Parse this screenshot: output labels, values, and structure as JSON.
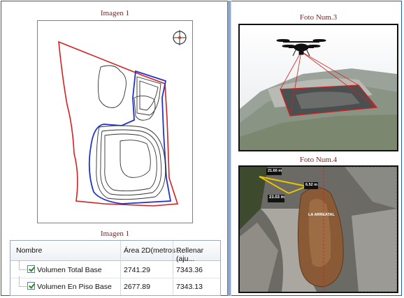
{
  "captions": {
    "map_top": "Imagen 1",
    "map_bottom": "Imagen 1",
    "photo3": "Foto Num.3",
    "photo4": "Foto Num.4"
  },
  "table": {
    "headers": [
      "Nombre",
      "Área 2D(metros ...",
      "Rellenar (aju..."
    ],
    "rows": [
      {
        "name": "Volumen Total Base",
        "area": "2741.29",
        "fill": "7343.36",
        "checked": true
      },
      {
        "name": "Volumen En Piso Base",
        "area": "2677.89",
        "fill": "7343.13",
        "checked": true
      }
    ]
  },
  "photo4_labels": {
    "measure_a": "21.66 m",
    "measure_b": "6.52 m",
    "measure_c": "23.03 m",
    "pile_label": "LA ARREATAL"
  },
  "colors": {
    "caption_text": "#8b1c1c",
    "boundary_red": "#d62020",
    "boundary_blue": "#2233cc",
    "frame_blue": "#1d5fa8"
  }
}
